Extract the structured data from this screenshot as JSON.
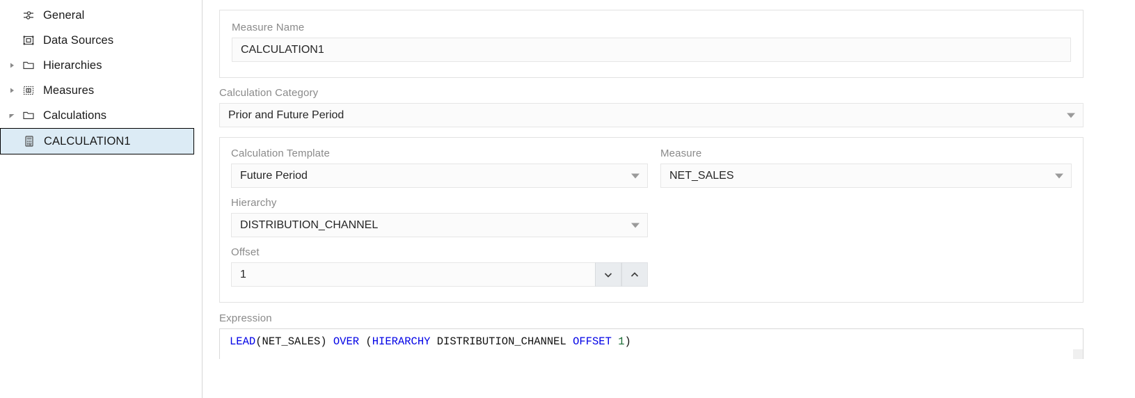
{
  "sidebar": {
    "items": [
      {
        "label": "General",
        "icon": "sliders-icon",
        "twisty": "none",
        "indent": 0,
        "selected": false
      },
      {
        "label": "Data Sources",
        "icon": "datasource-icon",
        "twisty": "none",
        "indent": 0,
        "selected": false
      },
      {
        "label": "Hierarchies",
        "icon": "folder-icon",
        "twisty": "collapsed",
        "indent": 0,
        "selected": false
      },
      {
        "label": "Measures",
        "icon": "measure-icon",
        "twisty": "collapsed",
        "indent": 0,
        "selected": false
      },
      {
        "label": "Calculations",
        "icon": "folder-icon",
        "twisty": "expanded",
        "indent": 0,
        "selected": false
      },
      {
        "label": "CALCULATION1",
        "icon": "calculator-icon",
        "twisty": "none",
        "indent": 1,
        "selected": true
      }
    ]
  },
  "form": {
    "measure_name": {
      "label": "Measure Name",
      "value": "CALCULATION1"
    },
    "calculation_category": {
      "label": "Calculation Category",
      "value": "Prior and Future Period"
    },
    "calculation_template": {
      "label": "Calculation Template",
      "value": "Future Period"
    },
    "measure": {
      "label": "Measure",
      "value": "NET_SALES"
    },
    "hierarchy": {
      "label": "Hierarchy",
      "value": "DISTRIBUTION_CHANNEL"
    },
    "offset": {
      "label": "Offset",
      "value": "1",
      "decrement_icon": "chevron-down-icon",
      "increment_icon": "chevron-up-icon"
    },
    "expression": {
      "label": "Expression",
      "text": "LEAD(NET_SALES) OVER (HIERARCHY DISTRIBUTION_CHANNEL OFFSET 1)",
      "tokens": [
        {
          "t": "LEAD",
          "k": "kw"
        },
        {
          "t": "(",
          "k": "pun"
        },
        {
          "t": "NET_SALES",
          "k": "id"
        },
        {
          "t": ")",
          "k": "pun"
        },
        {
          "t": " ",
          "k": "pun"
        },
        {
          "t": "OVER",
          "k": "kw"
        },
        {
          "t": " ",
          "k": "pun"
        },
        {
          "t": "(",
          "k": "pun"
        },
        {
          "t": "HIERARCHY",
          "k": "kw"
        },
        {
          "t": " ",
          "k": "pun"
        },
        {
          "t": "DISTRIBUTION_CHANNEL",
          "k": "id"
        },
        {
          "t": " ",
          "k": "pun"
        },
        {
          "t": "OFFSET",
          "k": "kw"
        },
        {
          "t": " ",
          "k": "pun"
        },
        {
          "t": "1",
          "k": "num"
        },
        {
          "t": ")",
          "k": "pun"
        }
      ]
    }
  },
  "colors": {
    "selection_bg": "#dcebf5",
    "keyword": "#0000e6",
    "number": "#1a6b34",
    "label_gray": "#8a8a8a",
    "field_bg": "#fbfbfb"
  }
}
